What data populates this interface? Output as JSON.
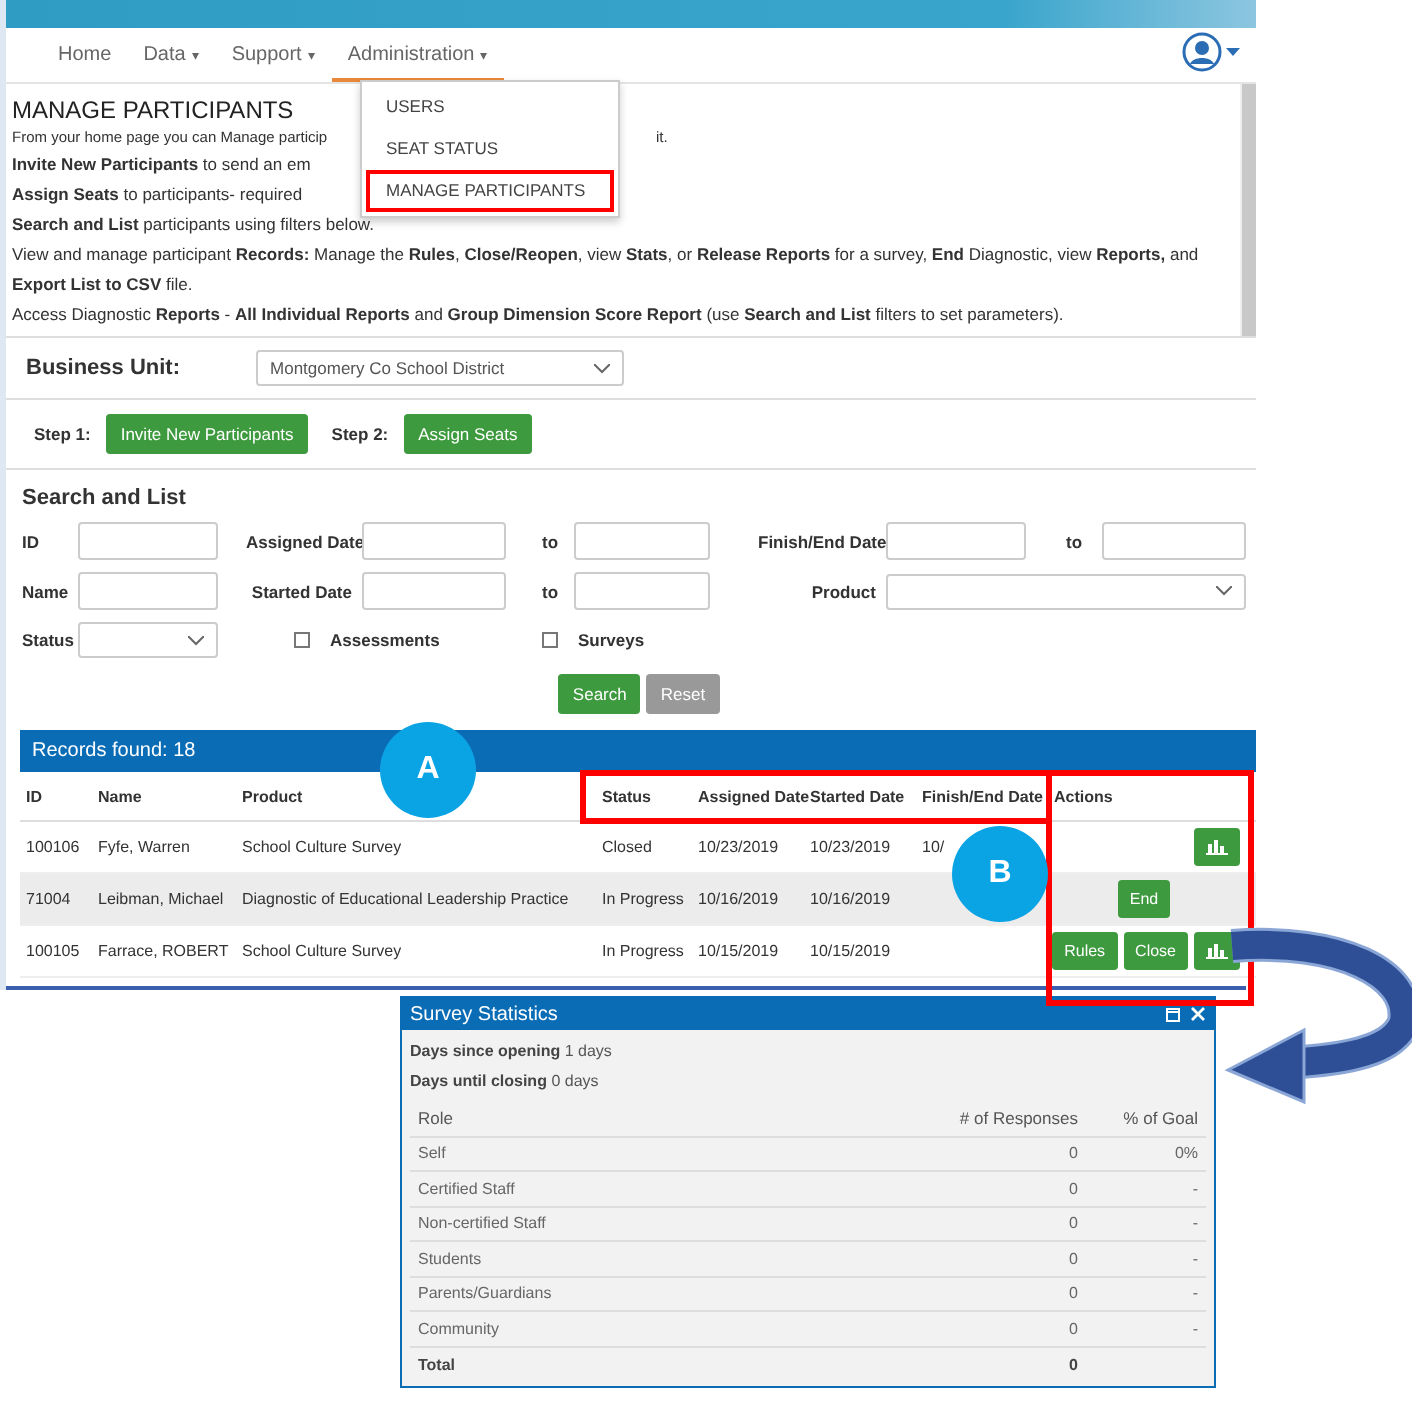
{
  "nav": {
    "items": [
      {
        "label": "Home",
        "selected": false
      },
      {
        "label": "Data",
        "caret": "▾",
        "selected": false
      },
      {
        "label": "Support",
        "caret": "▾",
        "selected": false
      },
      {
        "label": "Administration",
        "caret": "▾",
        "selected": true
      }
    ]
  },
  "dropdown_menu": [
    {
      "label": "USERS",
      "outlined": false
    },
    {
      "label": "SEAT STATUS",
      "outlined": false
    },
    {
      "label": "MANAGE PARTICIPANTS",
      "outlined": true
    }
  ],
  "page_title": "MANAGE PARTICIPANTS",
  "intro": [
    {
      "text": "From your home page you can Manage particip",
      "after": "it.",
      "small": true
    },
    {
      "text": "**Invite New Participants** to send an em",
      "small": false
    },
    {
      "text": "**Assign Seats** to participants- required",
      "small": false
    },
    {
      "text": "**Search and List** participants using filters below.",
      "small": false
    },
    {
      "text": "View and manage participant **Records:** Manage the **Rules**, **Close/Reopen**, view **Stats**, or **Release Reports** for a survey, **End** Diagnostic, view **Reports,** and **Export List to CSV** file.",
      "small": false
    },
    {
      "text": "Access Diagnostic **Reports** - **All Individual Reports** and **Group Dimension Score Report** (use **Search and List** filters to set parameters).",
      "small": false
    }
  ],
  "business_unit": {
    "label": "Business Unit:",
    "value": "Montgomery Co School District"
  },
  "steps": [
    {
      "label": "Step 1:",
      "button": "Invite New Participants"
    },
    {
      "label": "Step 2:",
      "button": "Assign Seats"
    }
  ],
  "search": {
    "title": "Search and List",
    "id_label": "ID",
    "name_label": "Name",
    "status_label": "Status",
    "assigned_label": "Assigned Date",
    "started_label": "Started Date",
    "to_label_1": "to",
    "to_label_2": "to",
    "to_label_3": "to",
    "finish_label": "Finish/End Date",
    "product_label": "Product",
    "checkboxes": [
      {
        "label": "Assessments",
        "checked": false
      },
      {
        "label": "Surveys",
        "checked": false
      }
    ],
    "buttons": [
      {
        "label": "Search",
        "kind": "primary"
      },
      {
        "label": "Reset",
        "kind": "secondary"
      }
    ]
  },
  "table": {
    "title": "Records found: 18",
    "columns": [
      "ID",
      "Name",
      "Product",
      "Status",
      "Assigned Date",
      "Started Date",
      "Finish/End Date",
      "Actions"
    ],
    "rows": [
      {
        "cells": [
          "100106",
          "Fyfe, Warren",
          "School Culture Survey",
          "Closed",
          "10/23/2019",
          "10/23/2019",
          "10/"
        ],
        "actions": [
          {
            "kind": "chart"
          }
        ]
      },
      {
        "cells": [
          "71004",
          "Leibman, Michael",
          "Diagnostic of Educational Leadership Practice",
          "In Progress",
          "10/16/2019",
          "10/16/2019",
          ""
        ],
        "actions": [
          {
            "kind": "text",
            "label": "End"
          }
        ]
      },
      {
        "cells": [
          "100105",
          "Farrace, ROBERT",
          "School Culture Survey",
          "In Progress",
          "10/15/2019",
          "10/15/2019",
          ""
        ],
        "actions": [
          {
            "kind": "text",
            "label": "Rules"
          },
          {
            "kind": "text",
            "label": "Close"
          },
          {
            "kind": "chart"
          }
        ]
      }
    ]
  },
  "callouts": [
    {
      "label": "A"
    },
    {
      "label": "B"
    }
  ],
  "stats_window": {
    "title": "Survey Statistics",
    "facts": [
      {
        "label": "Days since opening",
        "value": "1 days"
      },
      {
        "label": "Days until closing",
        "value": "0 days"
      }
    ],
    "columns": [
      "Role",
      "# of Responses",
      "% of Goal"
    ],
    "rows": [
      {
        "cells": [
          "Self",
          "0",
          "0%"
        ],
        "total": false
      },
      {
        "cells": [
          "Certified Staff",
          "0",
          "-"
        ],
        "total": false
      },
      {
        "cells": [
          "Non-certified Staff",
          "0",
          "-"
        ],
        "total": false
      },
      {
        "cells": [
          "Students",
          "0",
          "-"
        ],
        "total": false
      },
      {
        "cells": [
          "Parents/Guardians",
          "0",
          "-"
        ],
        "total": false
      },
      {
        "cells": [
          "Community",
          "0",
          "-"
        ],
        "total": false
      },
      {
        "cells": [
          "Total",
          "0",
          ""
        ],
        "total": true
      }
    ]
  }
}
